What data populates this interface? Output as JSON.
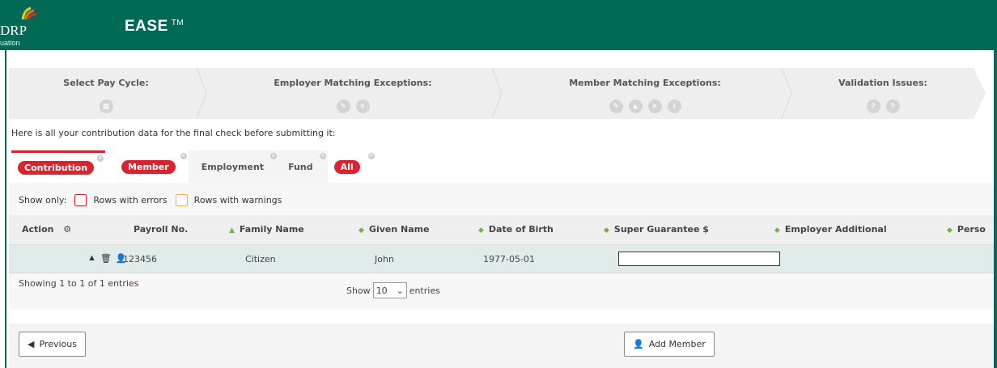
{
  "header": {
    "logo_text": "DRP",
    "logo_sub": "uation",
    "app_title": "EASE",
    "trademark": "TM",
    "brand_color": "#006a55"
  },
  "wizard": {
    "steps": [
      {
        "title": "Select Pay Cycle:",
        "icons": [
          "calendar-icon"
        ]
      },
      {
        "title": "Employer Matching Exceptions:",
        "icons": [
          "pencil-icon",
          "close-icon"
        ]
      },
      {
        "title": "Member Matching Exceptions:",
        "icons": [
          "pencil-icon",
          "warning-icon",
          "close-icon",
          "info-icon"
        ]
      },
      {
        "title": "Validation Issues:",
        "icons": [
          "question-icon",
          "question-icon"
        ]
      }
    ]
  },
  "intro_text": "Here is all your contribution data for the final check before submitting it:",
  "tabs": [
    {
      "label": "Contribution",
      "style": "pill",
      "active": true
    },
    {
      "label": "Member",
      "style": "pill",
      "active": false
    },
    {
      "label": "Employment",
      "style": "plain",
      "active": false
    },
    {
      "label": "Fund",
      "style": "plain",
      "active": false
    },
    {
      "label": "All",
      "style": "pill",
      "active": false
    }
  ],
  "filters": {
    "show_only": "Show only:",
    "errors_label": "Rows with errors",
    "warnings_label": "Rows with warnings",
    "error_color": "#d9232e",
    "warning_color": "#f0ad4e"
  },
  "table": {
    "columns": [
      "Action",
      "Payroll No.",
      "Family Name",
      "Given Name",
      "Date of Birth",
      "Super Guarantee $",
      "Employer Additional",
      "Perso"
    ],
    "rows": [
      {
        "payroll_no": "123456",
        "family_name": "Citizen",
        "given_name": "John",
        "dob": "1977-05-01",
        "super_guarantee": ""
      }
    ]
  },
  "table_info": "Showing 1 to 1 of 1 entries",
  "length_menu": {
    "show": "Show",
    "value": "10",
    "entries": "entries"
  },
  "buttons": {
    "previous": "Previous",
    "add_member": "Add Member"
  }
}
